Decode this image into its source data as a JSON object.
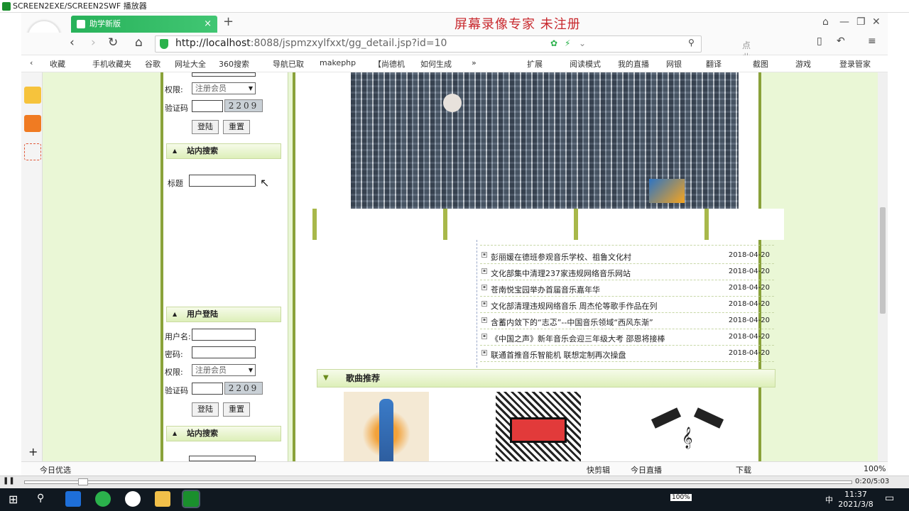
{
  "player": {
    "title": "SCREEN2EXE/SCREEN2SWF 播放器",
    "time": "0:20/5:03"
  },
  "browser": {
    "tab_title": "助学新版",
    "tab_close": "×",
    "new_tab": "+",
    "watermark": "屏幕录像专家  未注册",
    "url_host": "http://localhost",
    "url_rest": ":8088/jspmzxylfxxt/gg_detail.jsp?id=10",
    "search_placeholder": "点此搜索",
    "logo_letter": "e",
    "bookmarks": [
      "收藏",
      "手机收藏夹",
      "谷歌",
      "网址大全",
      "360搜索",
      "导航已取",
      "makephp",
      "【尚德机",
      "如何生成",
      "扩展",
      "阅读模式",
      "我的直播",
      "网银",
      "翻译",
      "截图",
      "游戏",
      "登录管家"
    ],
    "status_left": "今日优选",
    "status_items": [
      "快剪辑",
      "今日直播",
      "下载"
    ],
    "zoom": "100%"
  },
  "left": {
    "label_permission": "权限:",
    "label_captcha": "验证码",
    "select_member": "注册会员",
    "captcha_value": "2209",
    "btn_login": "登陆",
    "btn_reset": "重置",
    "search_head": "站内搜索",
    "title_label": "标题",
    "login_head": "用户登陆",
    "label_username": "用户名:",
    "label_password": "密码:"
  },
  "news": [
    {
      "title": "彭丽媛在德班参观音乐学校、祖鲁文化村",
      "date": "2018-04-20"
    },
    {
      "title": "文化部集中清理237家违规网络音乐网站",
      "date": "2018-04-20"
    },
    {
      "title": "苍南悦宝园举办首届音乐嘉年华",
      "date": "2018-04-20"
    },
    {
      "title": "文化部清理违规网络音乐 周杰伦等歌手作品在列",
      "date": "2018-04-20"
    },
    {
      "title": "含蓄内敛下的“志忑”--中国音乐领域“西风东渐”",
      "date": "2018-04-20"
    },
    {
      "title": "《中国之声》新年音乐会迎三年级大考 邵恩将接棒",
      "date": "2018-04-20"
    },
    {
      "title": "联通首推音乐智能机 联想定制再次操盘",
      "date": "2018-04-20"
    }
  ],
  "songs_head": "歌曲推荐",
  "taskbar": {
    "time": "11:37",
    "date": "2021/3/8",
    "battery": "100%",
    "ime": "中"
  }
}
